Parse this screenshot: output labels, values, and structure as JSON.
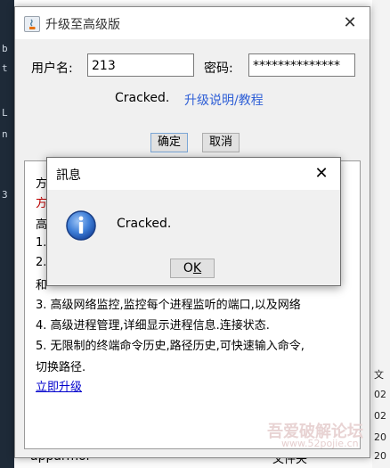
{
  "window": {
    "title": "升级至高级版",
    "username_label": "用户名:",
    "username_value": "213",
    "password_label": "密码:",
    "password_value": "**************",
    "status_text": "Cracked.",
    "guide_link": "升级说明/教程",
    "ok_button": "确定",
    "cancel_button": "取消"
  },
  "content": {
    "lines": [
      "方",
      "方",
      "高",
      "1.",
      "2.",
      "和",
      "3. 高级网络监控,监控每个进程监听的端口,以及网络",
      "4. 高级进程管理,详细显示进程信息.连接状态.",
      "5. 无限制的终端命令历史,路径历史,可快速输入命令,",
      "切换路径."
    ],
    "upgrade_link": "立即升级"
  },
  "dialog": {
    "title": "訊息",
    "message": "Cracked.",
    "ok_button_prefix": "O",
    "ok_button_underlined": "K"
  },
  "background": {
    "left_chars": [
      "b",
      "t",
      "L",
      "n",
      "3"
    ],
    "right_chars": [
      "文",
      "02",
      "02",
      "20",
      "20"
    ],
    "bottom_row_name": "apparmor",
    "bottom_row_type": "文件夹"
  },
  "watermark": {
    "text": "吾爱破解论坛",
    "url": "www.52pojie.cn"
  },
  "colors": {
    "link": "#2f5fd6",
    "red_text": "#c00000",
    "upgrade_link": "#0000cc"
  }
}
